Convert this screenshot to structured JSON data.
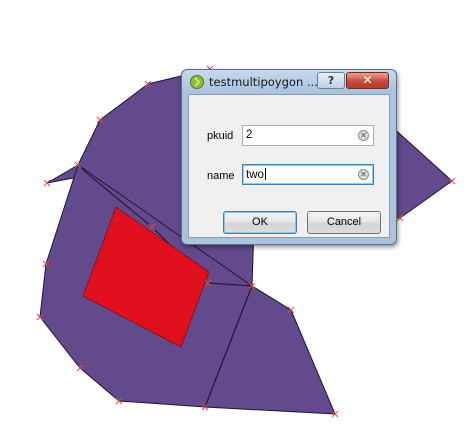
{
  "dialog": {
    "title": "testmultipoygon ...",
    "help_label": "?",
    "close_label": "✕",
    "icon": "qgis-app-icon",
    "fields": [
      {
        "label": "pkuid",
        "value": "2"
      },
      {
        "label": "name",
        "value": "two"
      }
    ],
    "clear_icon": "clear-field-icon",
    "ok_label": "OK",
    "cancel_label": "Cancel"
  },
  "map": {
    "polygon_fill": "#624a8c",
    "inner_fill": "#e0101e",
    "vertex_color": "#e04848"
  }
}
